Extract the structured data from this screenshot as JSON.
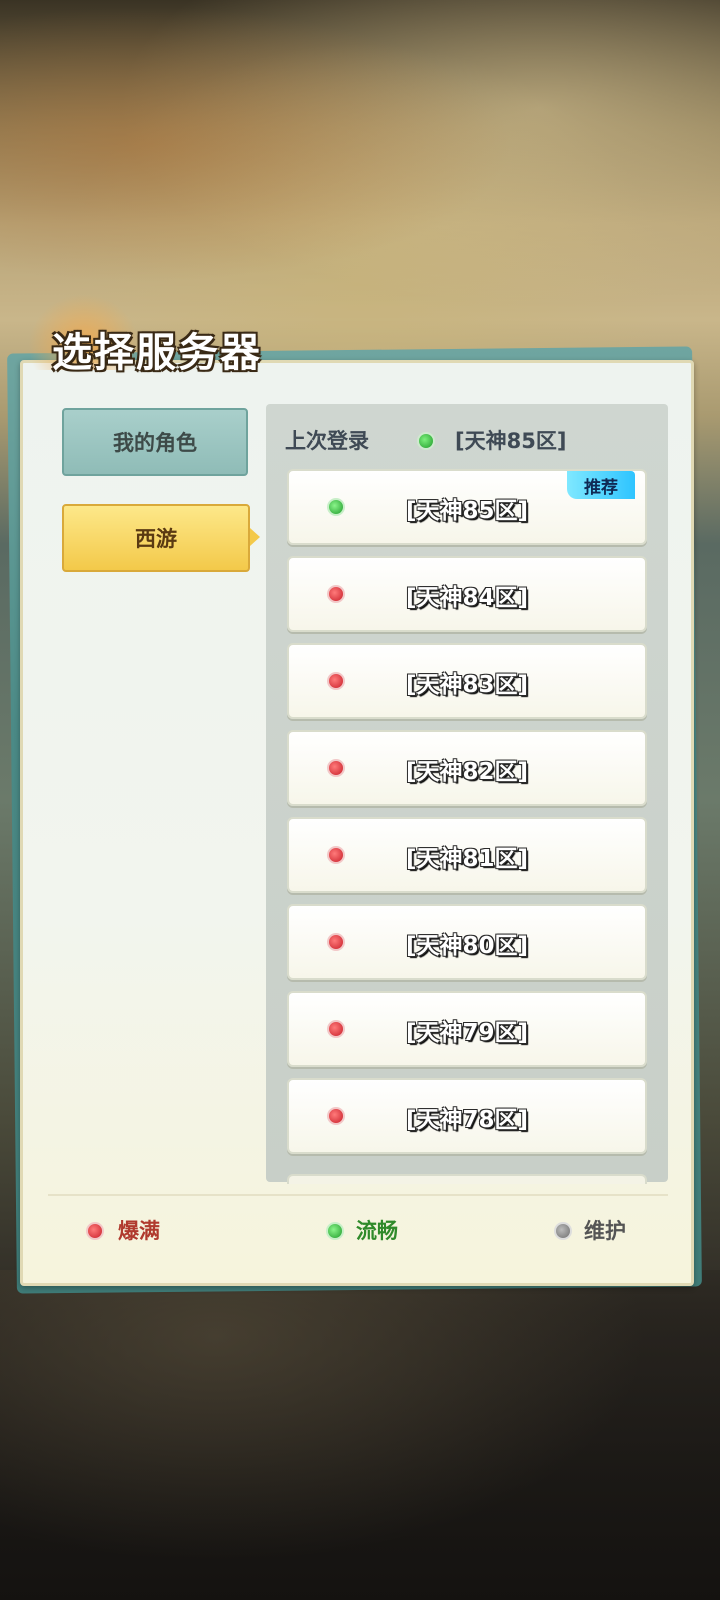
{
  "title": "选择服务器",
  "tabs": [
    {
      "label": "我的角色"
    },
    {
      "label": "西游"
    }
  ],
  "last_login": {
    "label": "上次登录",
    "server": "[天神85区]"
  },
  "servers": [
    {
      "name": "[天神85区]",
      "status": "green",
      "badge": "推荐"
    },
    {
      "name": "[天神84区]",
      "status": "red"
    },
    {
      "name": "[天神83区]",
      "status": "red"
    },
    {
      "name": "[天神82区]",
      "status": "red"
    },
    {
      "name": "[天神81区]",
      "status": "red"
    },
    {
      "name": "[天神80区]",
      "status": "red"
    },
    {
      "name": "[天神79区]",
      "status": "red"
    },
    {
      "name": "[天神78区]",
      "status": "red"
    }
  ],
  "legend": [
    {
      "label": "爆满",
      "color": "#b03a2e"
    },
    {
      "label": "流畅",
      "color": "#2f8a2a"
    },
    {
      "label": "维护",
      "color": "#555555"
    }
  ],
  "colors": {
    "status_red": "#c81f2a",
    "status_green": "#1f9a2a",
    "status_gray": "#777777",
    "accent_yellow": "#f3c94a",
    "accent_teal": "#8fbcb7"
  }
}
